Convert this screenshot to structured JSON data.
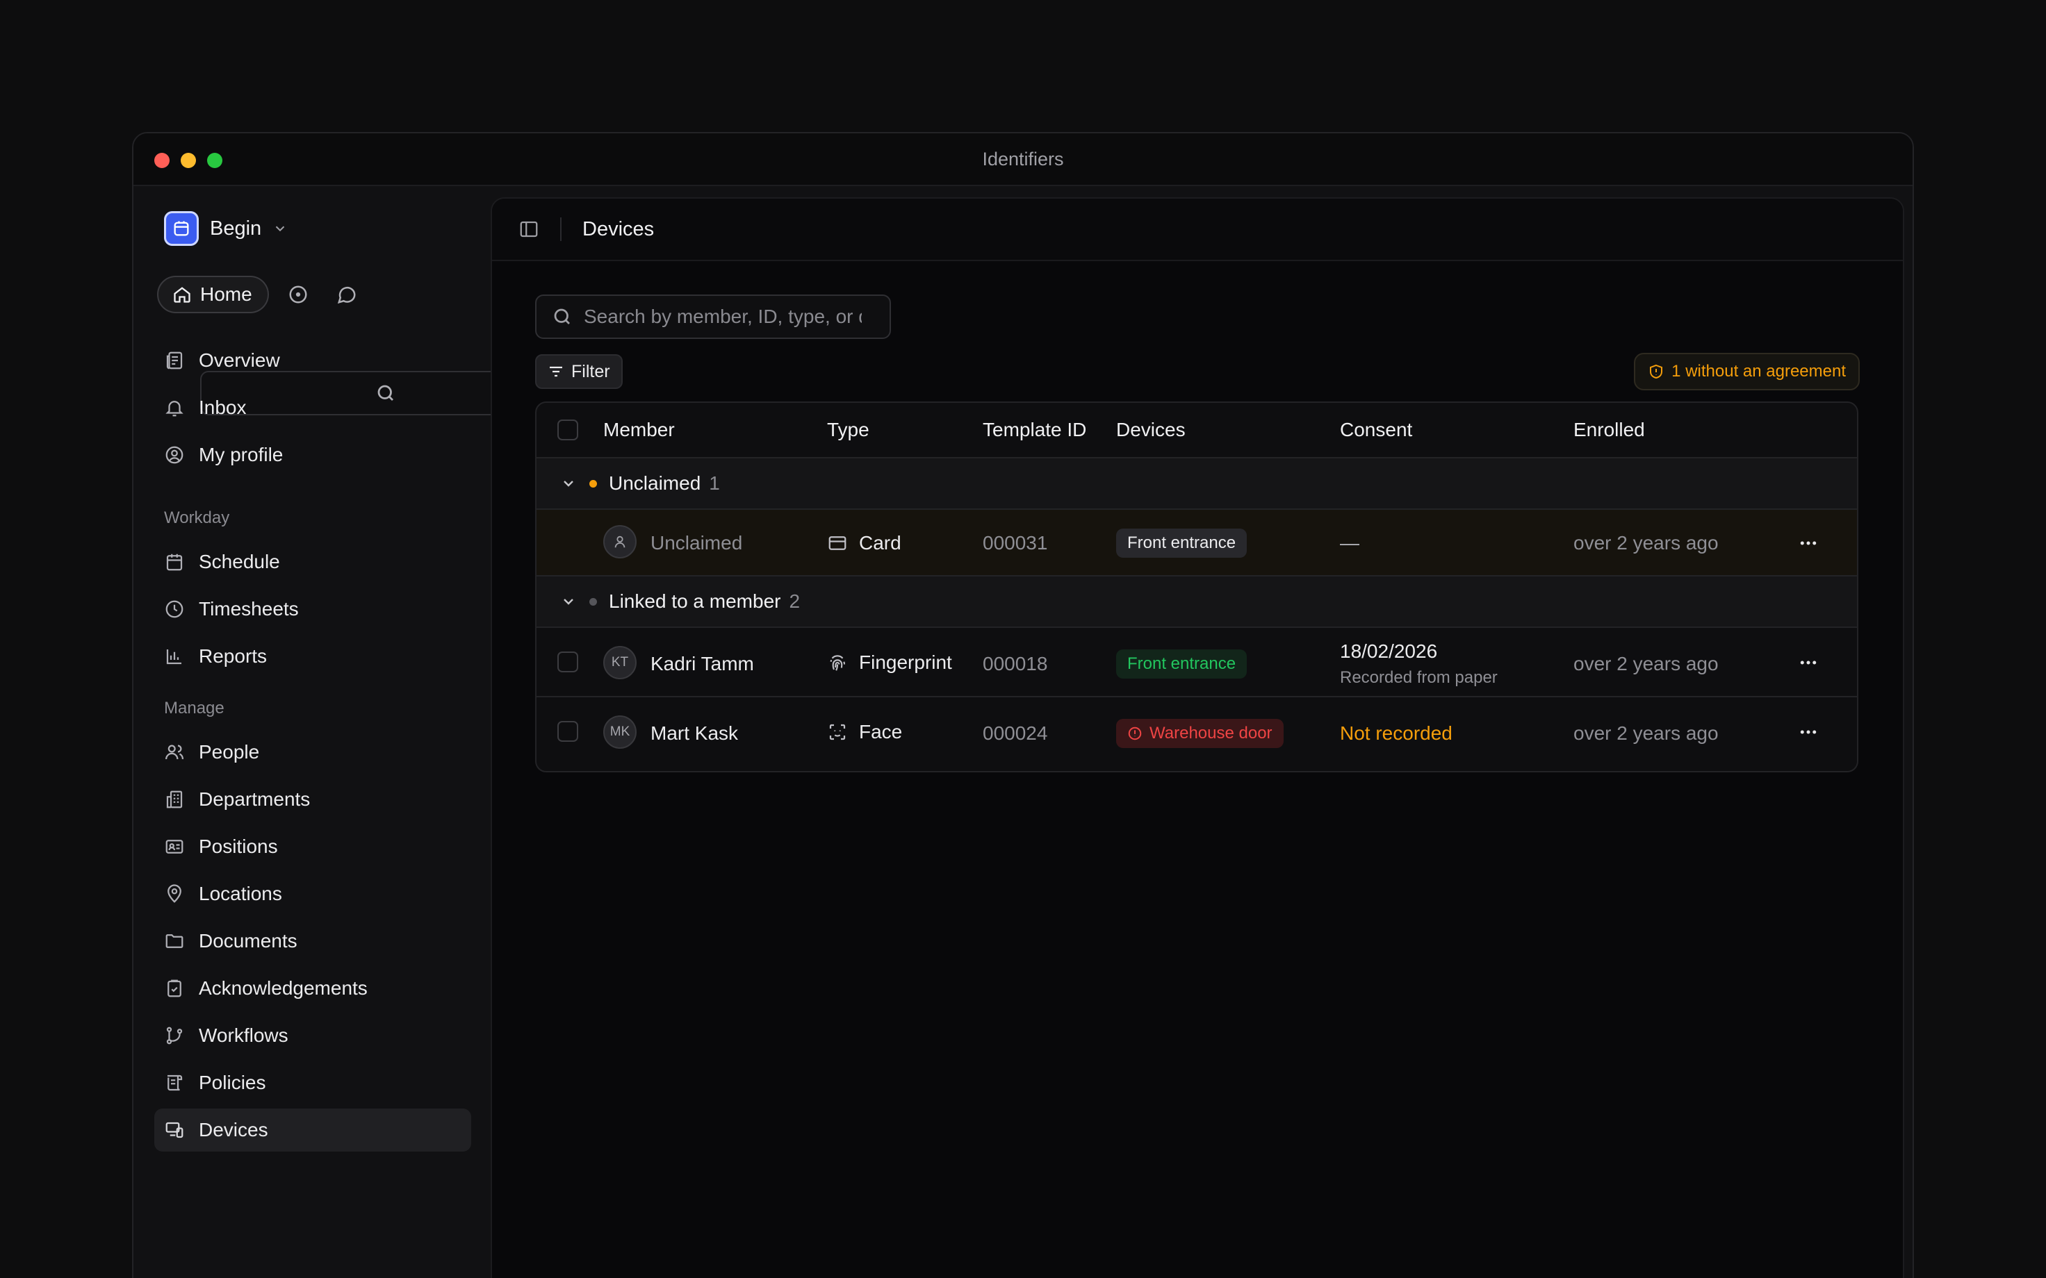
{
  "window": {
    "title": "Identifiers"
  },
  "sidebar": {
    "workspace": "Begin",
    "home_label": "Home",
    "items_top": [
      {
        "label": "Overview",
        "icon": "overview-icon"
      },
      {
        "label": "Inbox",
        "icon": "bell-icon"
      },
      {
        "label": "My profile",
        "icon": "user-circle-icon"
      }
    ],
    "section_workday": "Workday",
    "items_workday": [
      {
        "label": "Schedule",
        "icon": "calendar-icon"
      },
      {
        "label": "Timesheets",
        "icon": "clock-icon"
      },
      {
        "label": "Reports",
        "icon": "bar-chart-icon"
      }
    ],
    "section_manage": "Manage",
    "items_manage": [
      {
        "label": "People",
        "icon": "people-icon"
      },
      {
        "label": "Departments",
        "icon": "building-icon"
      },
      {
        "label": "Positions",
        "icon": "id-card-icon"
      },
      {
        "label": "Locations",
        "icon": "map-pin-icon"
      },
      {
        "label": "Documents",
        "icon": "folder-icon"
      },
      {
        "label": "Acknowledgements",
        "icon": "clipboard-check-icon"
      },
      {
        "label": "Workflows",
        "icon": "branch-icon"
      },
      {
        "label": "Policies",
        "icon": "scroll-icon"
      },
      {
        "label": "Devices",
        "icon": "devices-icon",
        "active": true
      }
    ]
  },
  "header": {
    "title": "Devices"
  },
  "search": {
    "placeholder": "Search by member, ID, type, or device"
  },
  "filter_label": "Filter",
  "agreement_badge": "1 without an agreement",
  "table": {
    "columns": [
      "Member",
      "Type",
      "Template ID",
      "Devices",
      "Consent",
      "Enrolled"
    ],
    "groups": [
      {
        "label": "Unclaimed",
        "count": "1",
        "dot_color": "#f59e0b",
        "rows": [
          {
            "initials": "",
            "member": "Unclaimed",
            "type": "Card",
            "template_id": "000031",
            "device": "Front entrance",
            "consent": "—",
            "enrolled": "over 2 years ago"
          }
        ]
      },
      {
        "label": "Linked to a member",
        "count": "2",
        "dot_color": "#55555a",
        "rows": [
          {
            "initials": "KT",
            "member": "Kadri Tamm",
            "type": "Fingerprint",
            "template_id": "000018",
            "device": "Front entrance",
            "consent": "18/02/2026",
            "consent_note": "Recorded from paper",
            "enrolled": "over 2 years ago"
          },
          {
            "initials": "MK",
            "member": "Mart Kask",
            "type": "Face",
            "template_id": "000024",
            "device": "Warehouse door",
            "consent": "Not recorded",
            "enrolled": "over 2 years ago"
          }
        ]
      }
    ]
  },
  "colors": {
    "accent": "#3b5cf0",
    "success": "#22c55e",
    "danger": "#ef4444",
    "warning": "#f59e0b"
  }
}
